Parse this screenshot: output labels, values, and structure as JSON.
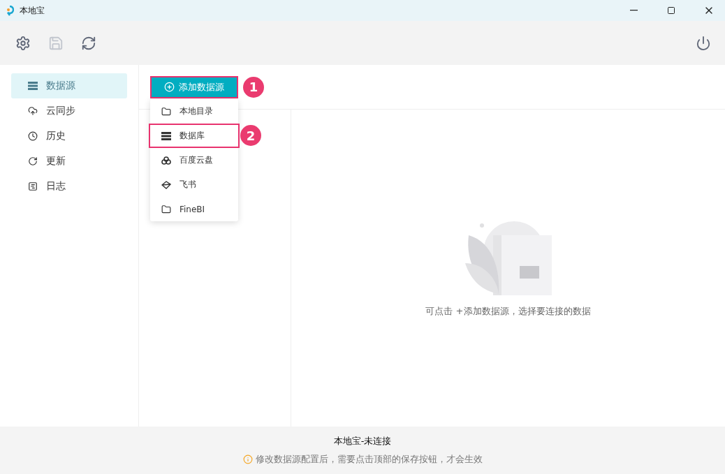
{
  "window": {
    "title": "本地宝"
  },
  "toolbar": {
    "buttons": [
      {
        "kind": "settings",
        "disabled": false
      },
      {
        "kind": "save",
        "disabled": true
      },
      {
        "kind": "refresh",
        "disabled": false
      }
    ]
  },
  "sidebar": {
    "items": [
      {
        "label": "数据源",
        "kind": "database",
        "selected": true
      },
      {
        "label": "云同步",
        "kind": "cloud",
        "selected": false
      },
      {
        "label": "历史",
        "kind": "clock",
        "selected": false
      },
      {
        "label": "更新",
        "kind": "update",
        "selected": false
      },
      {
        "label": "日志",
        "kind": "log",
        "selected": false
      }
    ]
  },
  "add_button": {
    "label": "添加数据源",
    "callout": "1"
  },
  "dropdown": {
    "items": [
      {
        "label": "本地目录",
        "kind": "folder",
        "highlighted": false
      },
      {
        "label": "数据库",
        "kind": "database",
        "highlighted": true,
        "callout": "2"
      },
      {
        "label": "百度云盘",
        "kind": "cloud",
        "highlighted": false
      },
      {
        "label": "飞书",
        "kind": "bird",
        "highlighted": false
      },
      {
        "label": "FineBI",
        "kind": "folder",
        "highlighted": false
      }
    ]
  },
  "empty_state": {
    "message": "可点击 +添加数据源，选择要连接的数据"
  },
  "status_bar": {
    "status": "本地宝-未连接",
    "hint": "修改数据源配置后，需要点击顶部的保存按钮，才会生效"
  }
}
